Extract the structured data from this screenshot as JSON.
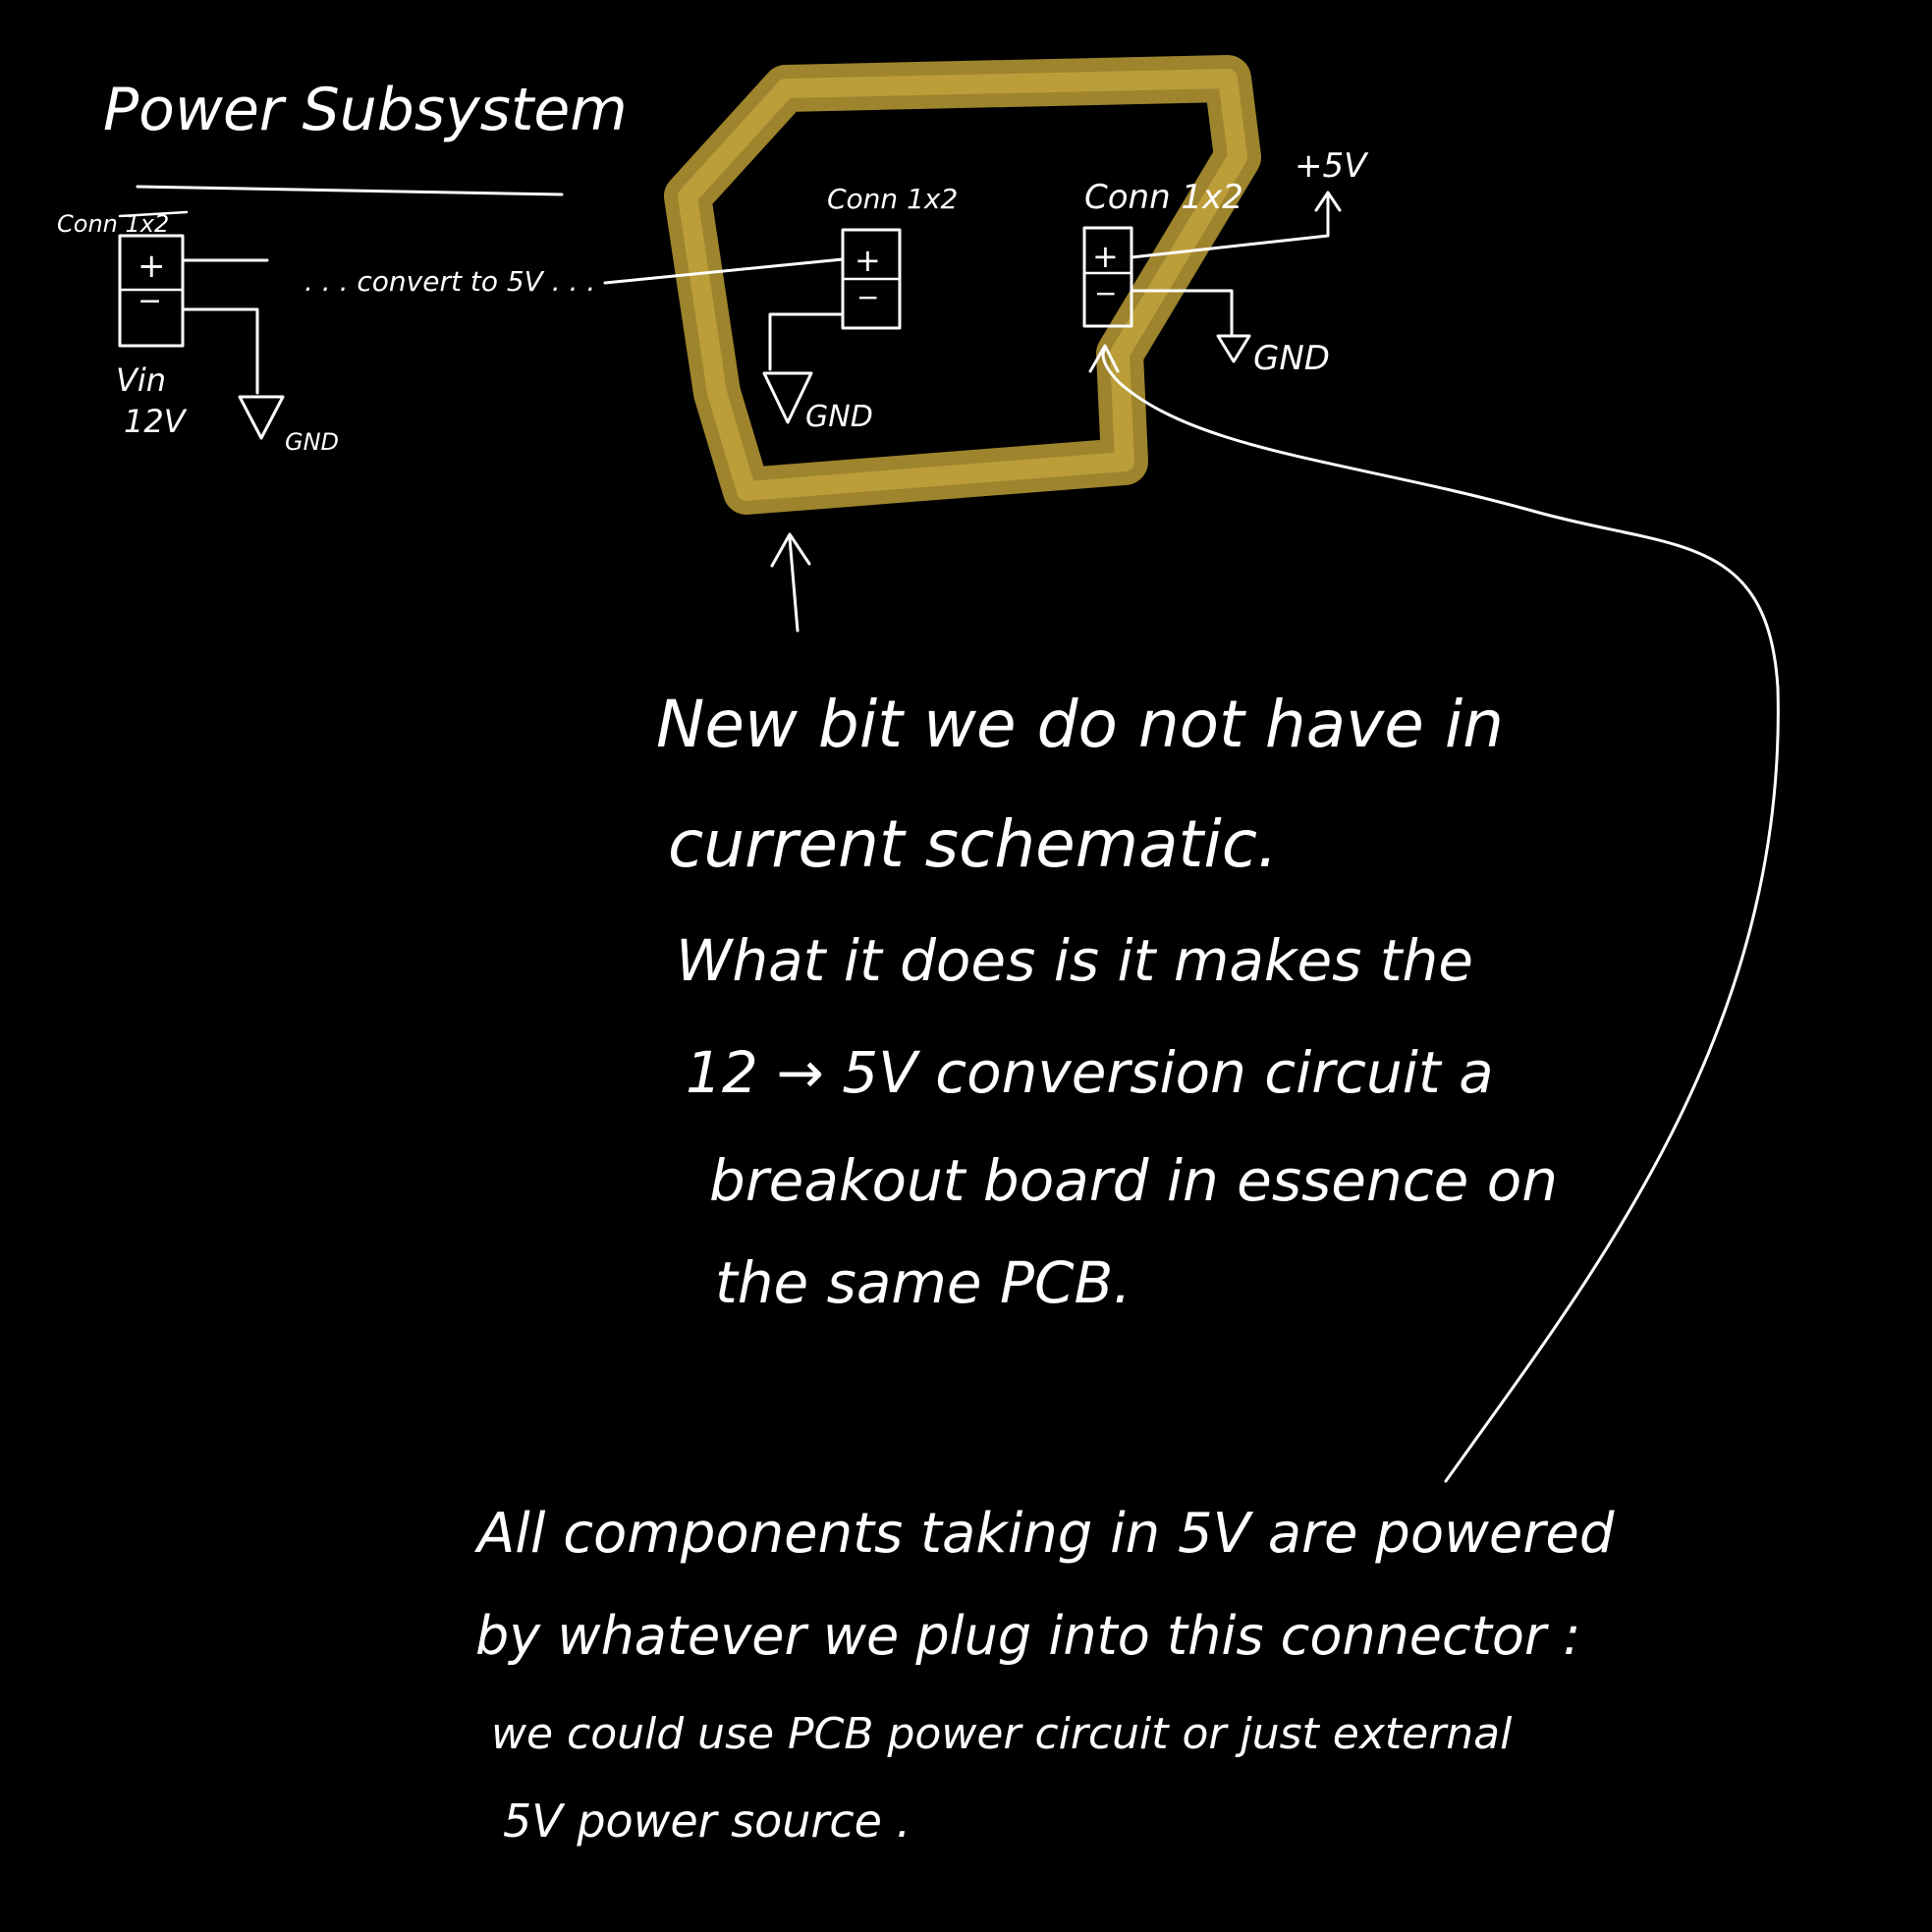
{
  "title": "Power Subsystem",
  "colors": {
    "background": "#000000",
    "ink": "#ffffff",
    "highlight": "#c9a93a"
  },
  "left_connector": {
    "label": "Conn 1x2",
    "plus": "+",
    "minus": "−",
    "vin_line1": "Vin",
    "vin_line2": "12V",
    "gnd": "GND",
    "convert_note": ". . . convert to 5V . . ."
  },
  "middle_connector": {
    "label": "Conn 1x2",
    "plus": "+",
    "minus": "−",
    "gnd": "GND"
  },
  "right_connector": {
    "label": "Conn 1x2",
    "plus": "+",
    "minus": "−",
    "gnd": "GND",
    "rail": "+5V"
  },
  "note_new_bit": {
    "line1": "New bit we do not have in",
    "line2": "current schematic.",
    "line3": "What it does is it makes the",
    "line4": "12 → 5V conversion circuit a",
    "line5": "breakout board in essence on",
    "line6": "the same PCB."
  },
  "note_connector": {
    "line1": "All components taking in 5V are powered",
    "line2": "by whatever we plug into this connector :",
    "line3": "we could use PCB power circuit or just external",
    "line4": "5V power source ."
  }
}
